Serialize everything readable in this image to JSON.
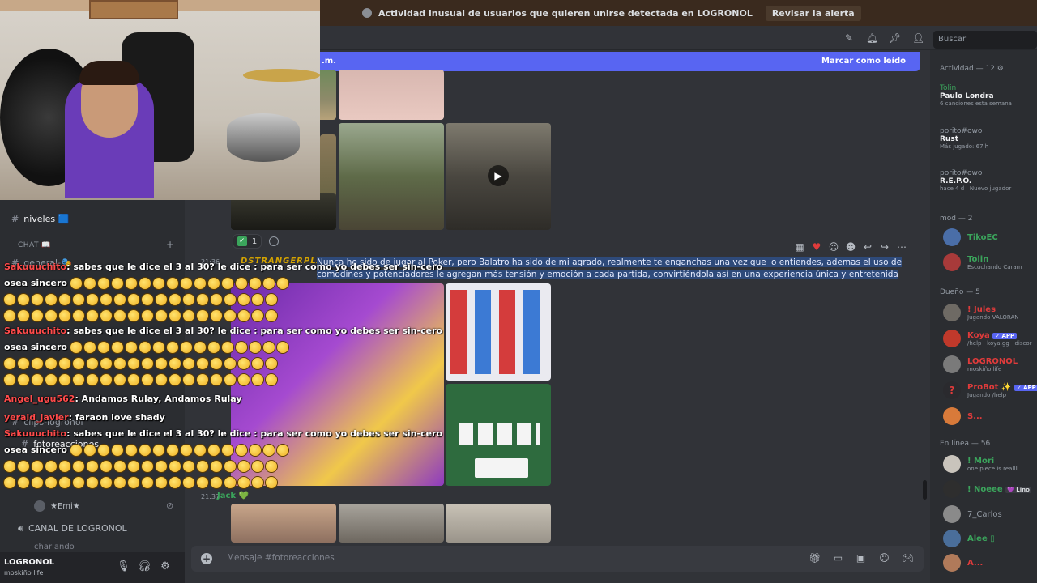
{
  "alert": {
    "text": "Actividad inusual de usuarios que quieren unirse detectada en LOGRONOL",
    "action": "Revisar la alerta"
  },
  "header": {
    "search_placeholder": "Buscar"
  },
  "new_messages": {
    "left": ".m.",
    "mark_read": "Marcar como leído"
  },
  "sidebar": {
    "channels": [
      {
        "name": "niveles",
        "badge": "🟦"
      },
      {
        "name": "general-🎭"
      },
      {
        "name": "clips-logronol"
      },
      {
        "name": "fotoreacciones"
      }
    ],
    "chat_category": "CHAT 📖",
    "voice_user": "★Emi★",
    "voice_channel": "CANAL DE LOGRONOL",
    "voice_channel_sub": "charlando"
  },
  "user_panel": {
    "name": "LOGRONOL",
    "status": "moskiño life"
  },
  "messages": [
    {
      "time": "21:36",
      "author": "DSTRANGERPLAY",
      "text": "Nunca he sido de jugar al Poker, pero Balatro ha sido de mi agrado, realmente te enganchas una vez que lo entiendes, ademas el uso de comodines y potenciadores le agregan más tensión y emoción a cada partida, convirtiéndola así en una experiencia única y entretenida"
    },
    {
      "time": "21:37",
      "author": "Jack 💚"
    }
  ],
  "reaction": {
    "count": "1"
  },
  "composer": {
    "placeholder": "Mensaje #fotoreacciones"
  },
  "members": {
    "activity_header": "Actividad — 12",
    "activity": [
      {
        "who": "Tolin",
        "what": "Paulo Londra",
        "detail": "6 canciones esta semana"
      },
      {
        "who": "porito#owo",
        "what": "Rust",
        "detail": "Más jugado: 67 h"
      },
      {
        "who": "porito#owo",
        "what": "R.E.P.O.",
        "detail": "hace 4 d · Nuevo jugador"
      }
    ],
    "mod_header": "mod — 2",
    "mods": [
      {
        "name": "TikoEC",
        "color": "#3ba55c",
        "status": ""
      },
      {
        "name": "Tolin",
        "color": "#3ba55c",
        "status": "Escuchando Caram"
      }
    ],
    "owner_header": "Dueño — 5",
    "owners": [
      {
        "name": "! Jules",
        "color": "#e03b3b",
        "status": "Jugando VALORAN"
      },
      {
        "name": "Koya",
        "color": "#e03b3b",
        "status": "/help · koya.gg · discor",
        "tag": "✓ APP"
      },
      {
        "name": "LOGRONOL",
        "color": "#e03b3b",
        "status": "moskiño life"
      },
      {
        "name": "ProBot ✨",
        "color": "#e03b3b",
        "status": "Jugando /help",
        "tag": "✓ APP"
      },
      {
        "name": "S...",
        "color": "#e03b3b",
        "status": ""
      }
    ],
    "online_header": "En línea — 56",
    "online": [
      {
        "name": "! Mori",
        "color": "#3ba55c",
        "status": "one piece is reallll"
      },
      {
        "name": "! Noeee",
        "color": "#3ba55c",
        "status": "",
        "tag": "💜 Lino"
      },
      {
        "name": "7_Carlos",
        "color": "#949ba4",
        "status": ""
      },
      {
        "name": "Alee ▯",
        "color": "#3ba55c",
        "status": ""
      },
      {
        "name": "A...",
        "color": "#e03b3b",
        "status": ""
      }
    ]
  },
  "stream_chat": {
    "lines": [
      {
        "user": "Sakuuuchito",
        "text": ": sabes que le dice el 3 al 30? le dice : para ser como yo debes ser sin-cero",
        "cont": "osea sincero",
        "emotes": 20,
        "rows": 2
      },
      {
        "user": "Sakuuuchito",
        "text": ": sabes que le dice el 3 al 30? le dice : para ser como yo debes ser sin-cero",
        "cont": "osea sincero",
        "emotes": 20,
        "rows": 2
      },
      {
        "user": "Angel_ugu562",
        "text": ": Andamos Rulay, Andamos Rulay"
      },
      {
        "user": "yerald_javier",
        "text": ": faraon love shady"
      },
      {
        "user": "Sakuuuchito",
        "text": ": sabes que le dice el 3 al 30? le dice : para ser como yo debes ser sin-cero",
        "cont": "osea sincero",
        "emotes": 20,
        "rows": 2
      }
    ]
  },
  "colors": {
    "accent": "#5865f2",
    "author_gold": "#d4a300",
    "online_green": "#3ba55c",
    "owner_red": "#e03b3b",
    "twitch_user_red": "#ff4b4b"
  }
}
